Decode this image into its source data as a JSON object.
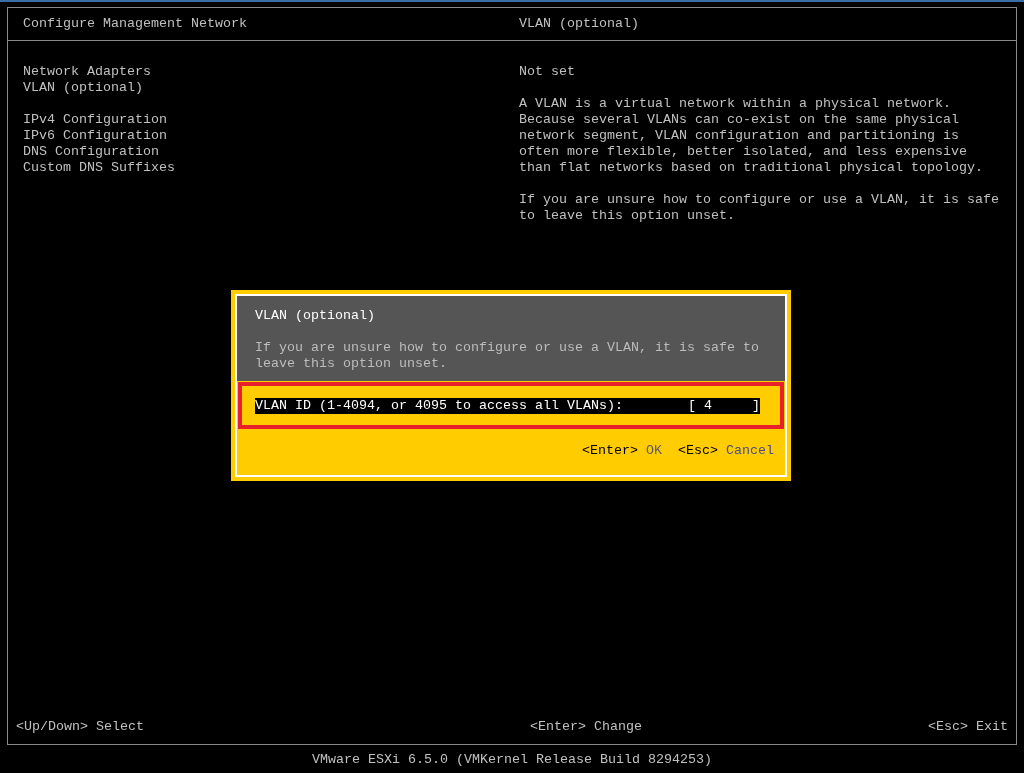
{
  "header": {
    "title": "Configure Management Network",
    "detail_title": "VLAN (optional)"
  },
  "menu_groups": [
    {
      "items": [
        "Network Adapters",
        "VLAN (optional)"
      ]
    },
    {
      "items": [
        "IPv4 Configuration",
        "IPv6 Configuration",
        "DNS Configuration",
        "Custom DNS Suffixes"
      ]
    }
  ],
  "detail": {
    "value": "Not set",
    "paragraphs": [
      "A VLAN is a virtual network within a physical network.\nBecause several VLANs can co-exist on the same physical\nnetwork segment, VLAN configuration and partitioning is\noften more flexible, better isolated, and less expensive\nthan flat networks based on traditional physical topology.",
      "If you are unsure how to configure or use a VLAN, it is safe\nto leave this option unset."
    ]
  },
  "dialog": {
    "title": "VLAN (optional)",
    "message": "If you are unsure how to configure or use a VLAN, it is safe to\nleave this option unset.",
    "field": {
      "label": "VLAN ID (1-4094, or 4095 to access all VLANs):",
      "open_bracket": "[",
      "value": "4",
      "close_bracket": "]"
    },
    "actions": [
      {
        "key": "<Enter>",
        "label": "OK",
        "kind": "ok"
      },
      {
        "key": "<Esc>",
        "label": "Cancel",
        "kind": "cancel"
      }
    ]
  },
  "footer": {
    "left": "<Up/Down> Select",
    "center": "<Enter> Change",
    "right": "<Esc> Exit"
  },
  "status_bar": "VMware ESXi 6.5.0 (VMKernel Release Build 8294253)"
}
